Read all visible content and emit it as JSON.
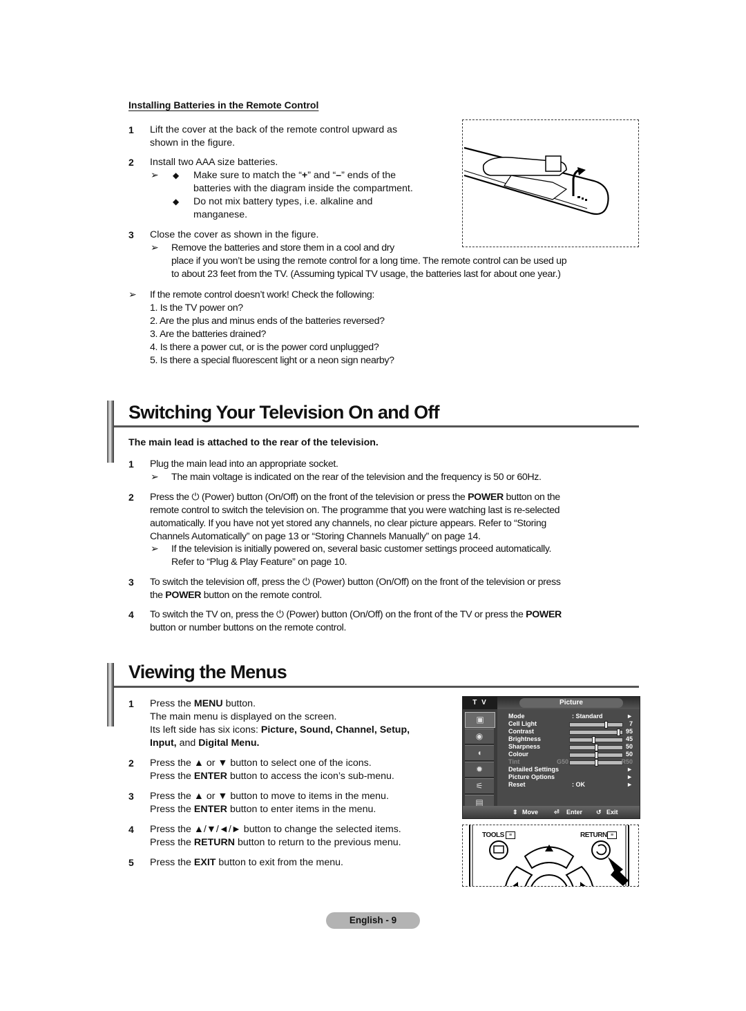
{
  "batteries": {
    "heading": "Installing Batteries in the Remote Control",
    "step1": {
      "num": "1",
      "line1": "Lift the cover at the back of the remote control upward as",
      "line2": "shown in the figure."
    },
    "step2": {
      "num": "2",
      "text": "Install two AAA size batteries.",
      "bullet1_line1_pre": "Make sure to match the “",
      "bullet1_plus": "+",
      "bullet1_line1_mid": "” and “",
      "bullet1_minus": "–",
      "bullet1_line1_post": "” ends of the",
      "bullet1_line2": "batteries with the diagram inside the compartment.",
      "bullet2_line1": "Do not mix battery types, i.e. alkaline and",
      "bullet2_line2": "manganese."
    },
    "step3": {
      "num": "3",
      "text": "Close the cover as shown in the figure.",
      "note_line1": "Remove the batteries and store them in a cool and dry",
      "note_line2": "place if you won’t be using the remote control for a long time. The remote control can be used up",
      "note_line3": "to about 23 feet from the TV. (Assuming typical TV usage, the batteries last for about one year.)"
    },
    "troubleshoot": {
      "intro": "If the remote control doesn’t work! Check the following:",
      "items": [
        "1. Is the TV power on?",
        "2. Are the plus and minus ends of the batteries reversed?",
        "3. Are the batteries drained?",
        "4. Is there a power cut, or is the power cord unplugged?",
        "5. Is there a special fluorescent light or a neon sign nearby?"
      ]
    },
    "figure_label": "remote-control-battery-cover-illustration"
  },
  "switching": {
    "title": "Switching Your Television On and Off",
    "subtitle": "The main lead is attached to the rear of the television.",
    "step1": {
      "num": "1",
      "text": "Plug the main lead into an appropriate socket.",
      "note": "The main voltage is indicated on the rear of the television and the frequency is 50 or 60Hz."
    },
    "step2": {
      "num": "2",
      "l1_a": "Press the",
      "l1_b": "(Power) button (On/Off) on the front of the television or press the",
      "l1_bold": "POWER",
      "l1_c": "button on the",
      "l2": "remote control to switch the television on. The programme that you were watching last is re-selected",
      "l3": "automatically. If you have not yet stored any channels, no clear picture appears. Refer to “Storing",
      "l4": "Channels Automatically” on page 13 or “Storing Channels Manually” on page 14.",
      "note1": "If the television is initially powered on, several basic customer settings proceed automatically.",
      "note2": "Refer to “Plug & Play Feature” on page 10."
    },
    "step3": {
      "num": "3",
      "l1_a": "To switch the television off, press the",
      "l1_b": "(Power) button (On/Off) on the front of the television or press",
      "l2_a": "the",
      "l2_bold": "POWER",
      "l2_b": "button on the remote control."
    },
    "step4": {
      "num": "4",
      "l1_a": "To switch the TV on, press the",
      "l1_b": "(Power) button (On/Off) on the front of the TV or press the",
      "l1_bold": "POWER",
      "l2": "button or number buttons on the remote control."
    },
    "power_glyph": "⏻"
  },
  "menus": {
    "title": "Viewing the Menus",
    "steps": [
      {
        "num": "1",
        "l1_a": "Press the",
        "l1_bold": "MENU",
        "l1_b": "button.",
        "l2": "The main menu is displayed on the screen.",
        "l3_a": "Its left side has six icons:",
        "l3_bold": "Picture, Sound, Channel, Setup,",
        "l4_bold1": "Input,",
        "l4_a": "and",
        "l4_bold2": "Digital Menu."
      },
      {
        "num": "2",
        "l1": "Press the ▲ or ▼ button to select one of the icons.",
        "l2_a": "Press the",
        "l2_bold": "ENTER",
        "l2_b": "button to access the icon’s sub-menu."
      },
      {
        "num": "3",
        "l1": "Press the ▲ or ▼ button to move to items in the menu.",
        "l2_a": "Press the",
        "l2_bold": "ENTER",
        "l2_b": "button to enter items in the menu."
      },
      {
        "num": "4",
        "l1": "Press the ▲/▼/◄/► button to change the selected items.",
        "l2_a": "Press the",
        "l2_bold": "RETURN",
        "l2_b": "button to return to the previous menu."
      },
      {
        "num": "5",
        "l1_a": "Press the",
        "l1_bold": "EXIT",
        "l1_b": "button to exit from the menu."
      }
    ]
  },
  "osd": {
    "source": "T V",
    "title": "Picture",
    "side_icons": [
      "picture-icon",
      "sound-icon",
      "channel-icon",
      "setup-icon",
      "input-icon",
      "digital-menu-icon"
    ],
    "rows": [
      {
        "label": "Mode",
        "value": ": Standard",
        "right": "►"
      },
      {
        "label": "Cell Light",
        "slider": 0.7,
        "right": "7"
      },
      {
        "label": "Contrast",
        "slider": 0.95,
        "right": "95"
      },
      {
        "label": "Brightness",
        "slider": 0.45,
        "right": "45"
      },
      {
        "label": "Sharpness",
        "slider": 0.5,
        "right": "50"
      },
      {
        "label": "Colour",
        "slider": 0.5,
        "right": "50"
      },
      {
        "label": "Tint",
        "left_val": "G50",
        "slider": 0.5,
        "right": "R50",
        "disabled": true
      },
      {
        "label": "Detailed Settings",
        "right": "►"
      },
      {
        "label": "Picture Options",
        "right": "►"
      },
      {
        "label": "Reset",
        "value": ": OK",
        "right": "►"
      }
    ],
    "footer": {
      "move": "Move",
      "enter": "Enter",
      "exit": "Exit"
    }
  },
  "remote_fig": {
    "tools": "TOOLS",
    "return": "RETURN"
  },
  "footer": {
    "page_label": "English - 9"
  }
}
